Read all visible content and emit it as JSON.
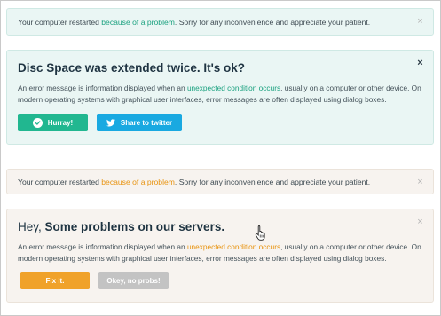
{
  "alerts": [
    {
      "text_before": "Your computer restarted ",
      "link": "because of a problem",
      "text_after": ". Sorry for any inconvenience and appreciate your patient.",
      "close": "×"
    },
    {
      "title": "Disc Space was extended twice. It's ok?",
      "body_before": "An error message is information displayed when an ",
      "body_link": "unexpected condition occurs",
      "body_after": ", usually on a computer or other device. On modern operating systems with graphical user interfaces, error messages are often displayed using dialog boxes.",
      "primary_button": "Hurray!",
      "secondary_button": "Share to twitter",
      "close": "×"
    },
    {
      "text_before": "Your computer restarted ",
      "link": "because of a problem",
      "text_after": ". Sorry for any inconvenience and appreciate your patient.",
      "close": "×"
    },
    {
      "title_light": "Hey, ",
      "title_bold": "Some problems on our servers.",
      "body_before": "An error message is information displayed when an ",
      "body_link": "unexpected condition occurs",
      "body_after": ", usually on a computer or other device. On modern operating systems with graphical user interfaces, error messages are often displayed using dialog boxes.",
      "primary_button": "Fix it.",
      "secondary_button": "Okey, no probs!",
      "close": "×"
    }
  ],
  "icons": {
    "check": "check-circle-icon",
    "twitter": "twitter-icon",
    "close": "close-icon",
    "cursor": "hand-pointer-icon"
  },
  "colors": {
    "green_accent": "#1aa17f",
    "green_button": "#21b790",
    "twitter_blue": "#19a9e1",
    "orange_accent": "#e8930f",
    "orange_button": "#f0a22a",
    "gray_button": "#c3c3c3"
  }
}
